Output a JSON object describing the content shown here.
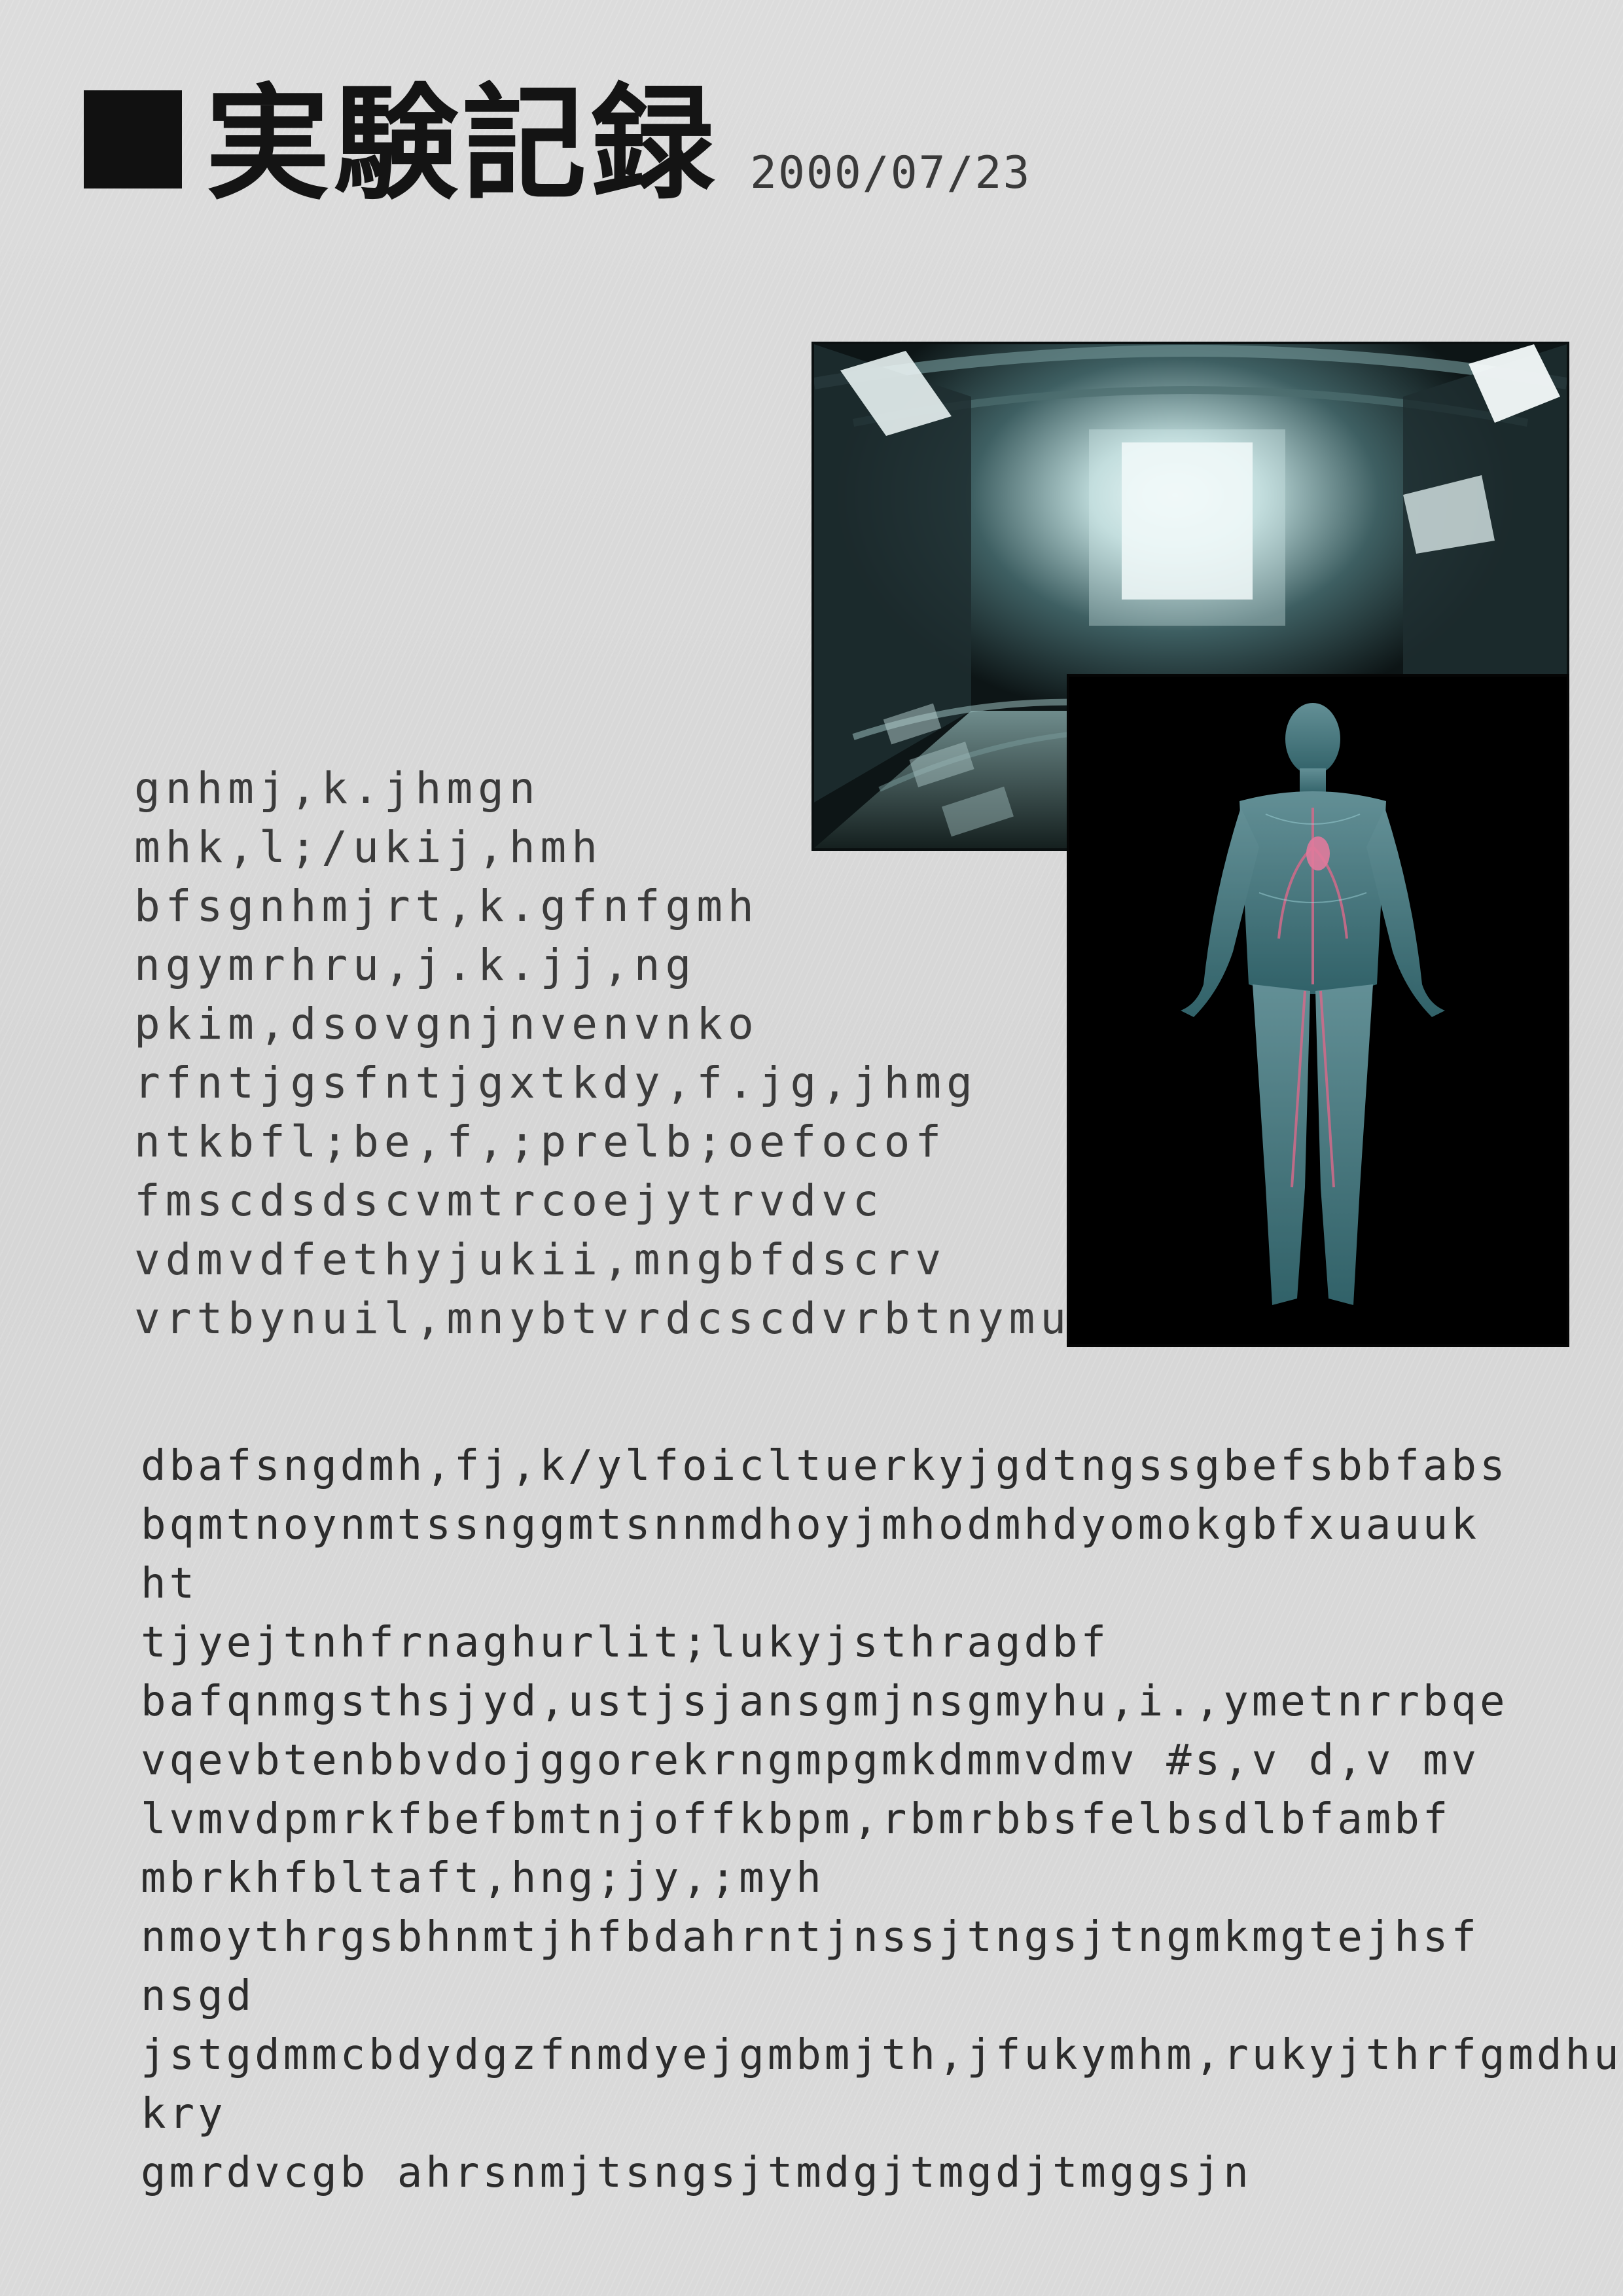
{
  "header": {
    "title": "実験記録",
    "date": "2000/07/23"
  },
  "images": {
    "corridor_photo": "sci-fi corridor photo",
    "body_photo": "human anatomy circulatory system illustration"
  },
  "text_block_1": [
    "gnhmj,k.jhmgn",
    "mhk,l;/ukij,hmh",
    "bfsgnhmjrt,k.gfnfgmh",
    "ngymrhru,j.k.jj,ng",
    "pkim,dsovgnjnvenvnko",
    "rfntjgsfntjgxtkdy,f.jg,jhmg",
    "ntkbfl;be,f,;prelb;oefocof",
    "fmscdsdscvmtrcoejytrvdvc",
    "vdmvdfethyjukii,mngbfdscrv",
    "vrtbynuil,mnybtvrdcscdvrbtnymu"
  ],
  "text_block_2": [
    "dbafsngdmh,fj,k/ylfoicltuerkyjgdtngssgbefsbbfabs",
    "bqmtnoynmtssnggmtsnnmdhoyjmhodmhdyomokgbfxuauuk",
    "ht",
    "tjyejtnhfrnaghurlit;lukyjsthragdbf",
    "bafqnmgsthsjyd,ustjsjansgmjnsgmyhu,i.,ymetnrrbqe",
    "vqevbtenbbvdojggorekrngmpgmkdmmvdmv #s,v d,v mv",
    "lvmvdpmrkfbefbmtnjoffkbpm,rbmrbbsfelbsdlbfambf",
    "mbrkhfbltaft,hng;jy,;myh",
    "nmoythrgsbhnmtjhfbdahrntjnssjtngsjtngmkmgtejhsf",
    "nsgd",
    "jstgdmmcbdydgzfnmdyejgmbmjth,jfukymhm,rukyjthrfgmdhuk",
    "kry",
    "gmrdvcgb ahrsnmjtsngsjtmdgjtmgdjtmggsjn"
  ]
}
